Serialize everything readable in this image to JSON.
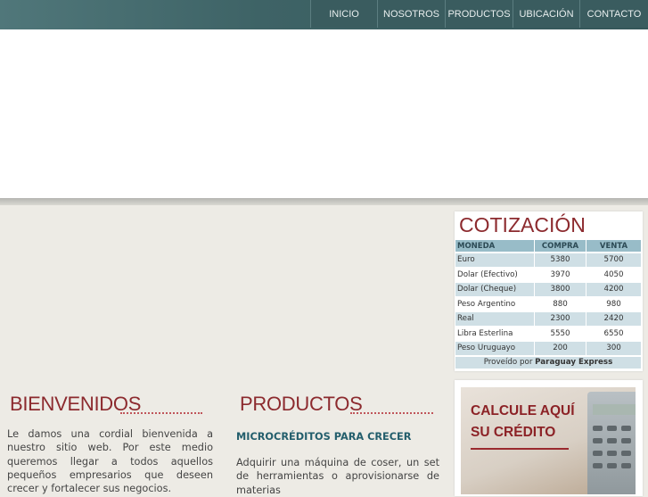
{
  "nav": [
    "INICIO",
    "NOSOTROS",
    "PRODUCTOS",
    "UBICACIÓN",
    "CONTACTO"
  ],
  "bienvenidos": {
    "title": "BIENVENIDOS",
    "text": "Le damos una cordial bienvenida a nuestro sitio web. Por este medio queremos llegar a todos aquellos pequeños empresarios que deseen crecer y fortalecer sus negocios."
  },
  "productos": {
    "title": "PRODUCTOS",
    "subtitle": "MICROCRÉDITOS PARA CRECER",
    "text": "Adquirir una máquina de coser, un set de herramientas o aprovisionarse de materias"
  },
  "cotizacion": {
    "title": "COTIZACIÓN",
    "headers": [
      "MONEDA",
      "COMPRA",
      "VENTA"
    ],
    "rows": [
      [
        "Euro",
        "5380",
        "5700"
      ],
      [
        "Dolar (Efectivo)",
        "3970",
        "4050"
      ],
      [
        "Dolar (Cheque)",
        "3800",
        "4200"
      ],
      [
        "Peso Argentino",
        "880",
        "980"
      ],
      [
        "Real",
        "2300",
        "2420"
      ],
      [
        "Libra Esterlina",
        "5550",
        "6550"
      ],
      [
        "Peso Uruguayo",
        "200",
        "300"
      ]
    ],
    "provider_prefix": "Proveído por",
    "provider": "Paraguay Express"
  },
  "calculadora": {
    "line1": "CALCULE AQUÍ",
    "line2": "SU CRÉDITO"
  }
}
